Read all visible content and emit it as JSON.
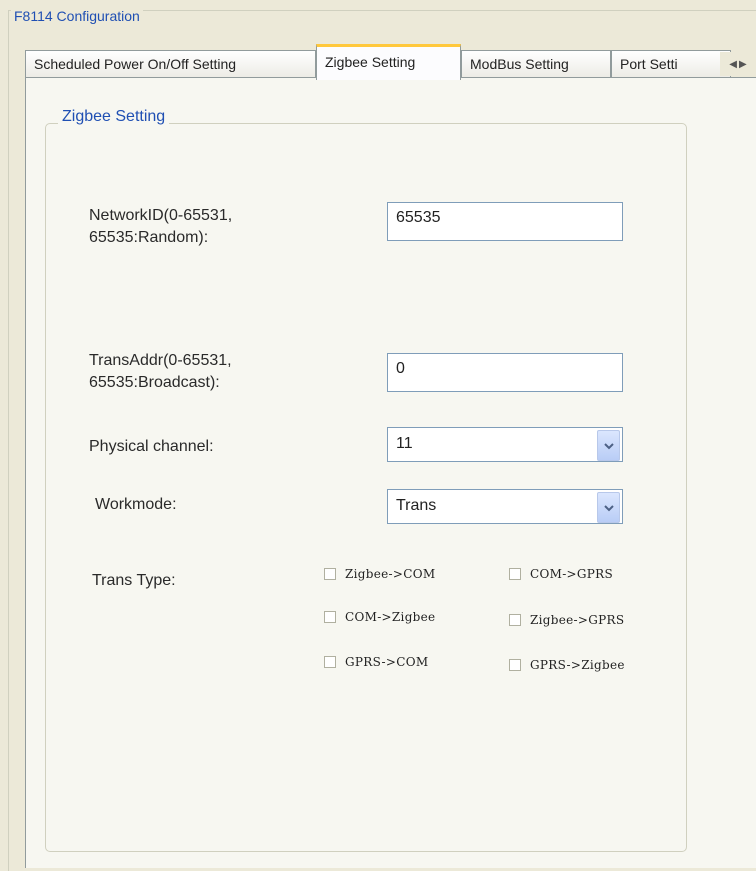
{
  "window": {
    "title": "F8114 Configuration"
  },
  "tabs": [
    {
      "label": "Scheduled Power On/Off Setting",
      "active": false
    },
    {
      "label": "Zigbee Setting",
      "active": true
    },
    {
      "label": "ModBus Setting",
      "active": false
    },
    {
      "label": "Port Setti",
      "active": false
    }
  ],
  "tab_nav": {
    "left": "◀",
    "right": "▶"
  },
  "panel": {
    "group_title": "Zigbee Setting",
    "network_id": {
      "label_line1": "NetworkID(0-65531,",
      "label_line2": "65535:Random):",
      "value": "65535"
    },
    "trans_addr": {
      "label_line1": "TransAddr(0-65531,",
      "label_line2": "65535:Broadcast):",
      "value": "0"
    },
    "physical_channel": {
      "label": "Physical channel:",
      "value": "11"
    },
    "workmode": {
      "label": "Workmode:",
      "value": "Trans"
    },
    "trans_type": {
      "label": "Trans Type:",
      "options": [
        {
          "label": "Zigbee->COM",
          "checked": false
        },
        {
          "label": "COM->GPRS",
          "checked": false
        },
        {
          "label": "COM->Zigbee",
          "checked": false
        },
        {
          "label": "Zigbee->GPRS",
          "checked": false
        },
        {
          "label": "GPRS->COM",
          "checked": false
        },
        {
          "label": "GPRS->Zigbee",
          "checked": false
        }
      ]
    }
  },
  "colors": {
    "legend_blue": "#1f4fb3",
    "active_tab_accent": "#ffc83c",
    "window_bg": "#ece9d8"
  }
}
